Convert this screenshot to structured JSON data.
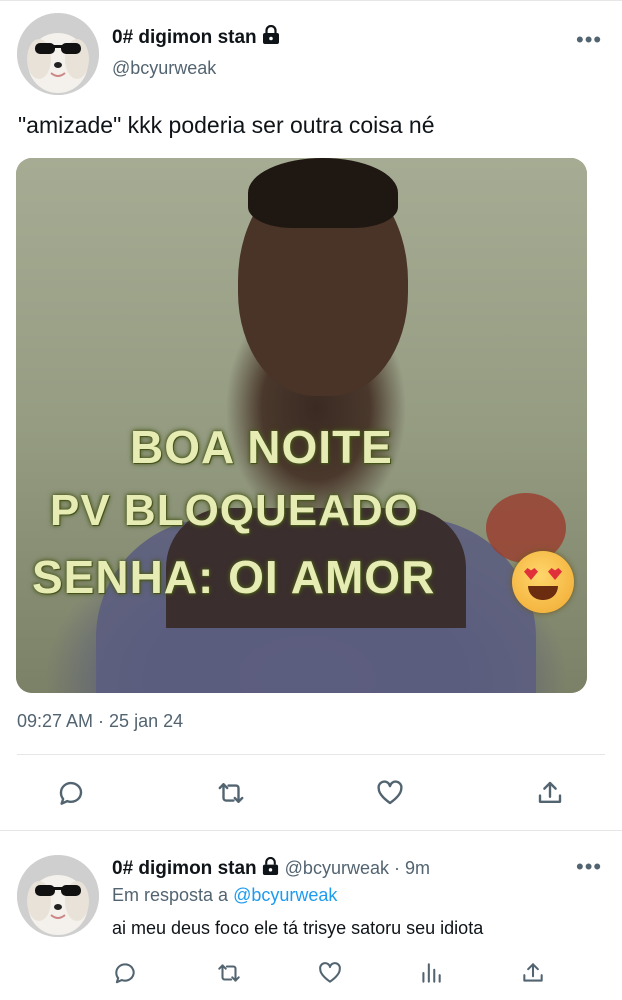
{
  "tweet": {
    "display_name": "0# digimon stan",
    "handle": "@bcyurweak",
    "text": "\"amizade\" kkk poderia ser outra coisa né",
    "image_caption_lines": [
      "BOA NOITE",
      "PV BLOQUEADO",
      "SENHA: OI AMOR"
    ],
    "timestamp": "09:27 AM · 25 jan 24",
    "more_icon": "•••"
  },
  "actions": {
    "reply_icon": "reply-icon",
    "retweet_icon": "retweet-icon",
    "like_icon": "like-icon",
    "share_icon": "share-icon"
  },
  "reply": {
    "display_name": "0# digimon stan",
    "handle_time": "@bcyurweak · 9m",
    "replying_prefix": "Em resposta a",
    "replying_to": "@bcyurweak",
    "text": "ai meu deus foco ele tá trisye satoru seu idiota",
    "more_icon": "•••"
  },
  "colors": {
    "text_primary": "#0f1419",
    "text_secondary": "#536471",
    "link": "#1d9bf0",
    "divider": "#e6e6e6"
  }
}
